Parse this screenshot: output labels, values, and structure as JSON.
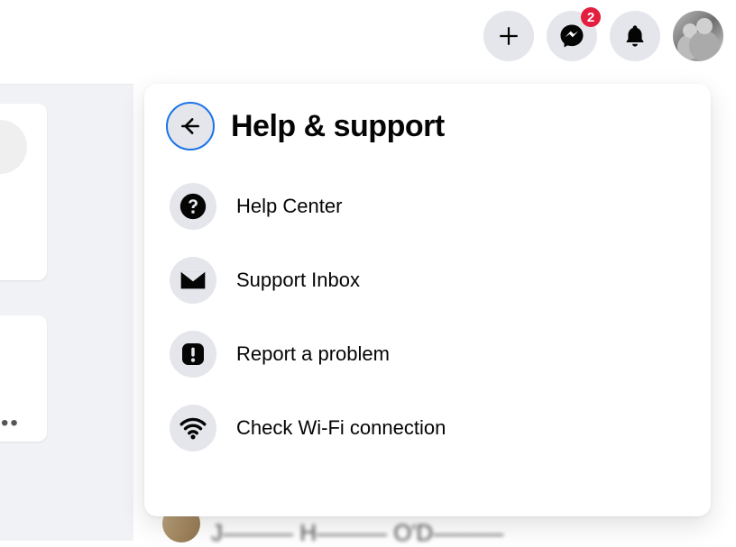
{
  "topbar": {
    "messenger_badge": "2"
  },
  "panel": {
    "title": "Help & support",
    "items": [
      {
        "key": "help-center",
        "label": "Help Center"
      },
      {
        "key": "support-inbox",
        "label": "Support Inbox"
      },
      {
        "key": "report",
        "label": "Report a problem"
      },
      {
        "key": "wifi",
        "label": "Check Wi-Fi connection"
      }
    ]
  },
  "background": {
    "partial_name": "J——— H——— O'D———"
  }
}
